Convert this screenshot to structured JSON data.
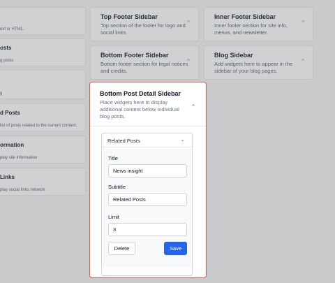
{
  "widgets_list": [
    {
      "title": "",
      "desc": "ext or HTML."
    },
    {
      "title": "osts",
      "desc": "g posts"
    },
    {
      "title": "",
      "desc": "g"
    },
    {
      "title": "d Posts",
      "desc": "list of posts related to the current content."
    },
    {
      "title": "ormation",
      "desc": "play site information"
    },
    {
      "title": "Links",
      "desc": "play social links network"
    }
  ],
  "sidebars": {
    "top_footer": {
      "title": "Top Footer Sidebar",
      "desc": "Top section of the footer for logo and social links."
    },
    "inner_footer": {
      "title": "Inner Footer Sidebar",
      "desc": "Inner footer section for site info, menus, and newsletter."
    },
    "bottom_footer": {
      "title": "Bottom Footer Sidebar",
      "desc": "Bottom footer section for legal notices and credits."
    },
    "blog": {
      "title": "Blog Sidebar",
      "desc": "Add widgets here to appear in the sidebar of your blog pages."
    },
    "bottom_post_detail": {
      "title": "Bottom Post Detail Sidebar",
      "desc": "Place widgets here to display additional content below individual blog posts."
    }
  },
  "widget": {
    "name": "Related Posts",
    "fields": {
      "title": {
        "label": "Title",
        "value": "News insight"
      },
      "subtitle": {
        "label": "Subtitle",
        "value": "Related Posts"
      },
      "limit": {
        "label": "Limit",
        "value": "3"
      }
    },
    "delete_label": "Delete",
    "save_label": "Save"
  },
  "icons": {
    "chevron_up": "^",
    "chevron_down": "⌄"
  },
  "colors": {
    "highlight_border": "#e05a47",
    "save_button": "#2563eb",
    "backdrop": "#c8cacc"
  }
}
